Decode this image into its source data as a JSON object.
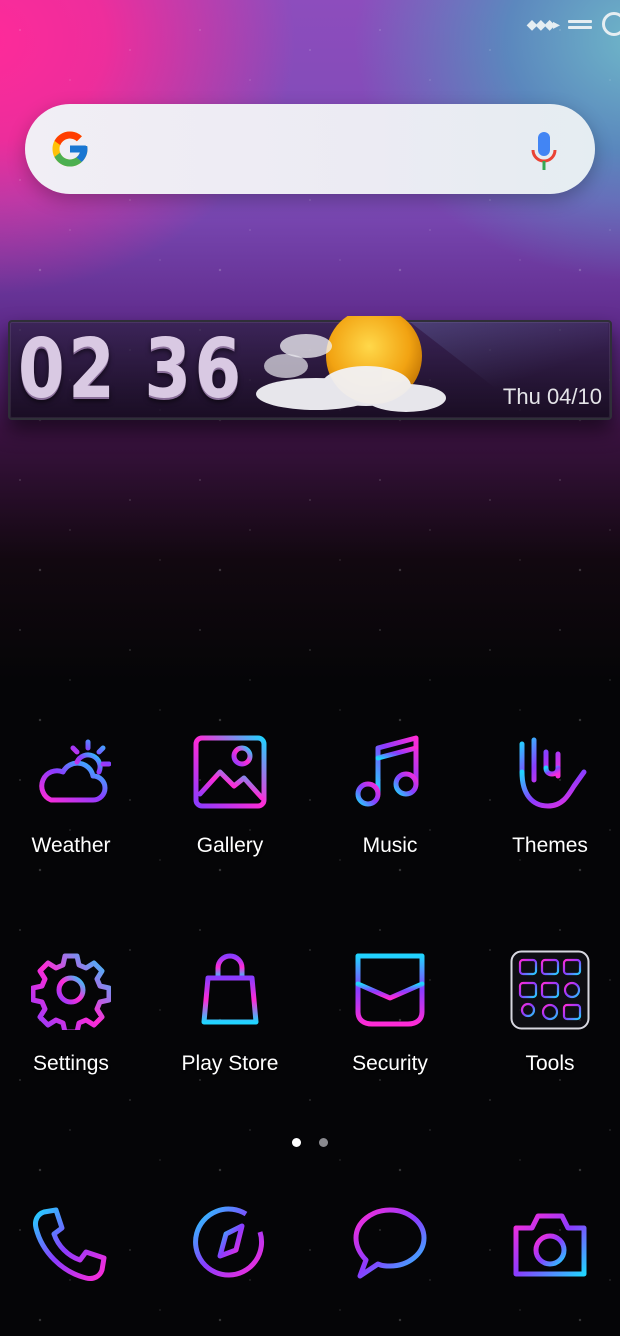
{
  "status_bar": {
    "icons": [
      "data-arrows-icon",
      "signal-bars-icon",
      "ring-icon"
    ]
  },
  "search": {
    "logo": "google-g-icon",
    "mic": "mic-icon"
  },
  "clock": {
    "hours": "02",
    "minutes": "36",
    "date": "Thu 04/10",
    "weather_icon": "sun-cloud-icon"
  },
  "apps": [
    {
      "label": "Weather",
      "icon": "weather-icon"
    },
    {
      "label": "Gallery",
      "icon": "gallery-icon"
    },
    {
      "label": "Music",
      "icon": "music-icon"
    },
    {
      "label": "Themes",
      "icon": "themes-icon"
    },
    {
      "label": "Settings",
      "icon": "settings-icon"
    },
    {
      "label": "Play Store",
      "icon": "play-store-icon"
    },
    {
      "label": "Security",
      "icon": "security-icon"
    },
    {
      "label": "Tools",
      "icon": "tools-folder-icon"
    }
  ],
  "page_indicator": {
    "pages": 2,
    "current": 1
  },
  "dock": [
    {
      "icon": "phone-icon"
    },
    {
      "icon": "compass-icon"
    },
    {
      "icon": "messages-icon"
    },
    {
      "icon": "camera-icon"
    }
  ],
  "colors": {
    "neon_pink": "#ff2bd6",
    "neon_purple": "#8a3cff",
    "neon_cyan": "#21d4ff",
    "label": "#ffffff"
  }
}
